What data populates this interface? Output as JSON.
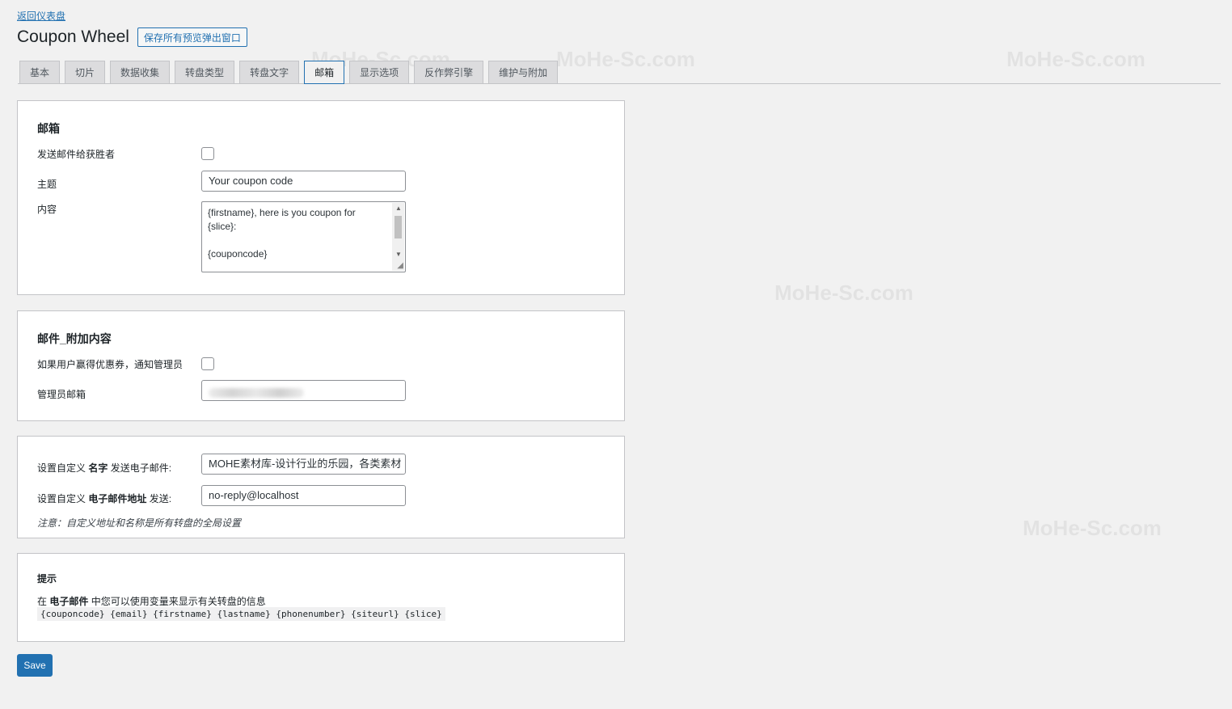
{
  "header": {
    "back_link": "返回仪表盘",
    "title": "Coupon Wheel",
    "save_preview_label": "保存所有预览弹出窗口"
  },
  "tabs": [
    {
      "label": "基本"
    },
    {
      "label": "切片"
    },
    {
      "label": "数据收集"
    },
    {
      "label": "转盘类型"
    },
    {
      "label": "转盘文字"
    },
    {
      "label": "邮箱",
      "active": true
    },
    {
      "label": "显示选项"
    },
    {
      "label": "反作弊引擎"
    },
    {
      "label": "维护与附加"
    }
  ],
  "email_section": {
    "heading": "邮箱",
    "send_to_winner_label": "发送邮件给获胜者",
    "send_to_winner_checked": false,
    "subject_label": "主题",
    "subject_value": "Your coupon code",
    "content_label": "内容",
    "content_value": "{firstname}, here is you coupon for\n{slice}:\n\n{couponcode}"
  },
  "addon_section": {
    "heading": "邮件_附加内容",
    "notify_admin_label": "如果用户赢得优惠券，通知管理员",
    "notify_admin_checked": false,
    "admin_email_label": "管理员邮箱"
  },
  "sender_section": {
    "name_label_pre": "设置自定义 ",
    "name_label_bold": "名字",
    "name_label_post": " 发送电子邮件:",
    "name_value": "MOHE素材库-设计行业的乐园，各类素材",
    "address_label_pre": "设置自定义 ",
    "address_label_bold": "电子邮件地址",
    "address_label_post": " 发送:",
    "address_value": "no-reply@localhost",
    "note": "注意：自定义地址和名称是所有转盘的全局设置"
  },
  "tips_section": {
    "heading": "提示",
    "text_pre": "在 ",
    "text_bold": "电子邮件",
    "text_post": " 中您可以使用变量来显示有关转盘的信息",
    "variables": "{couponcode} {email} {firstname} {lastname} {phonenumber} {siteurl} {slice}"
  },
  "save_label": "Save",
  "watermark": "MoHe-Sc.com"
}
